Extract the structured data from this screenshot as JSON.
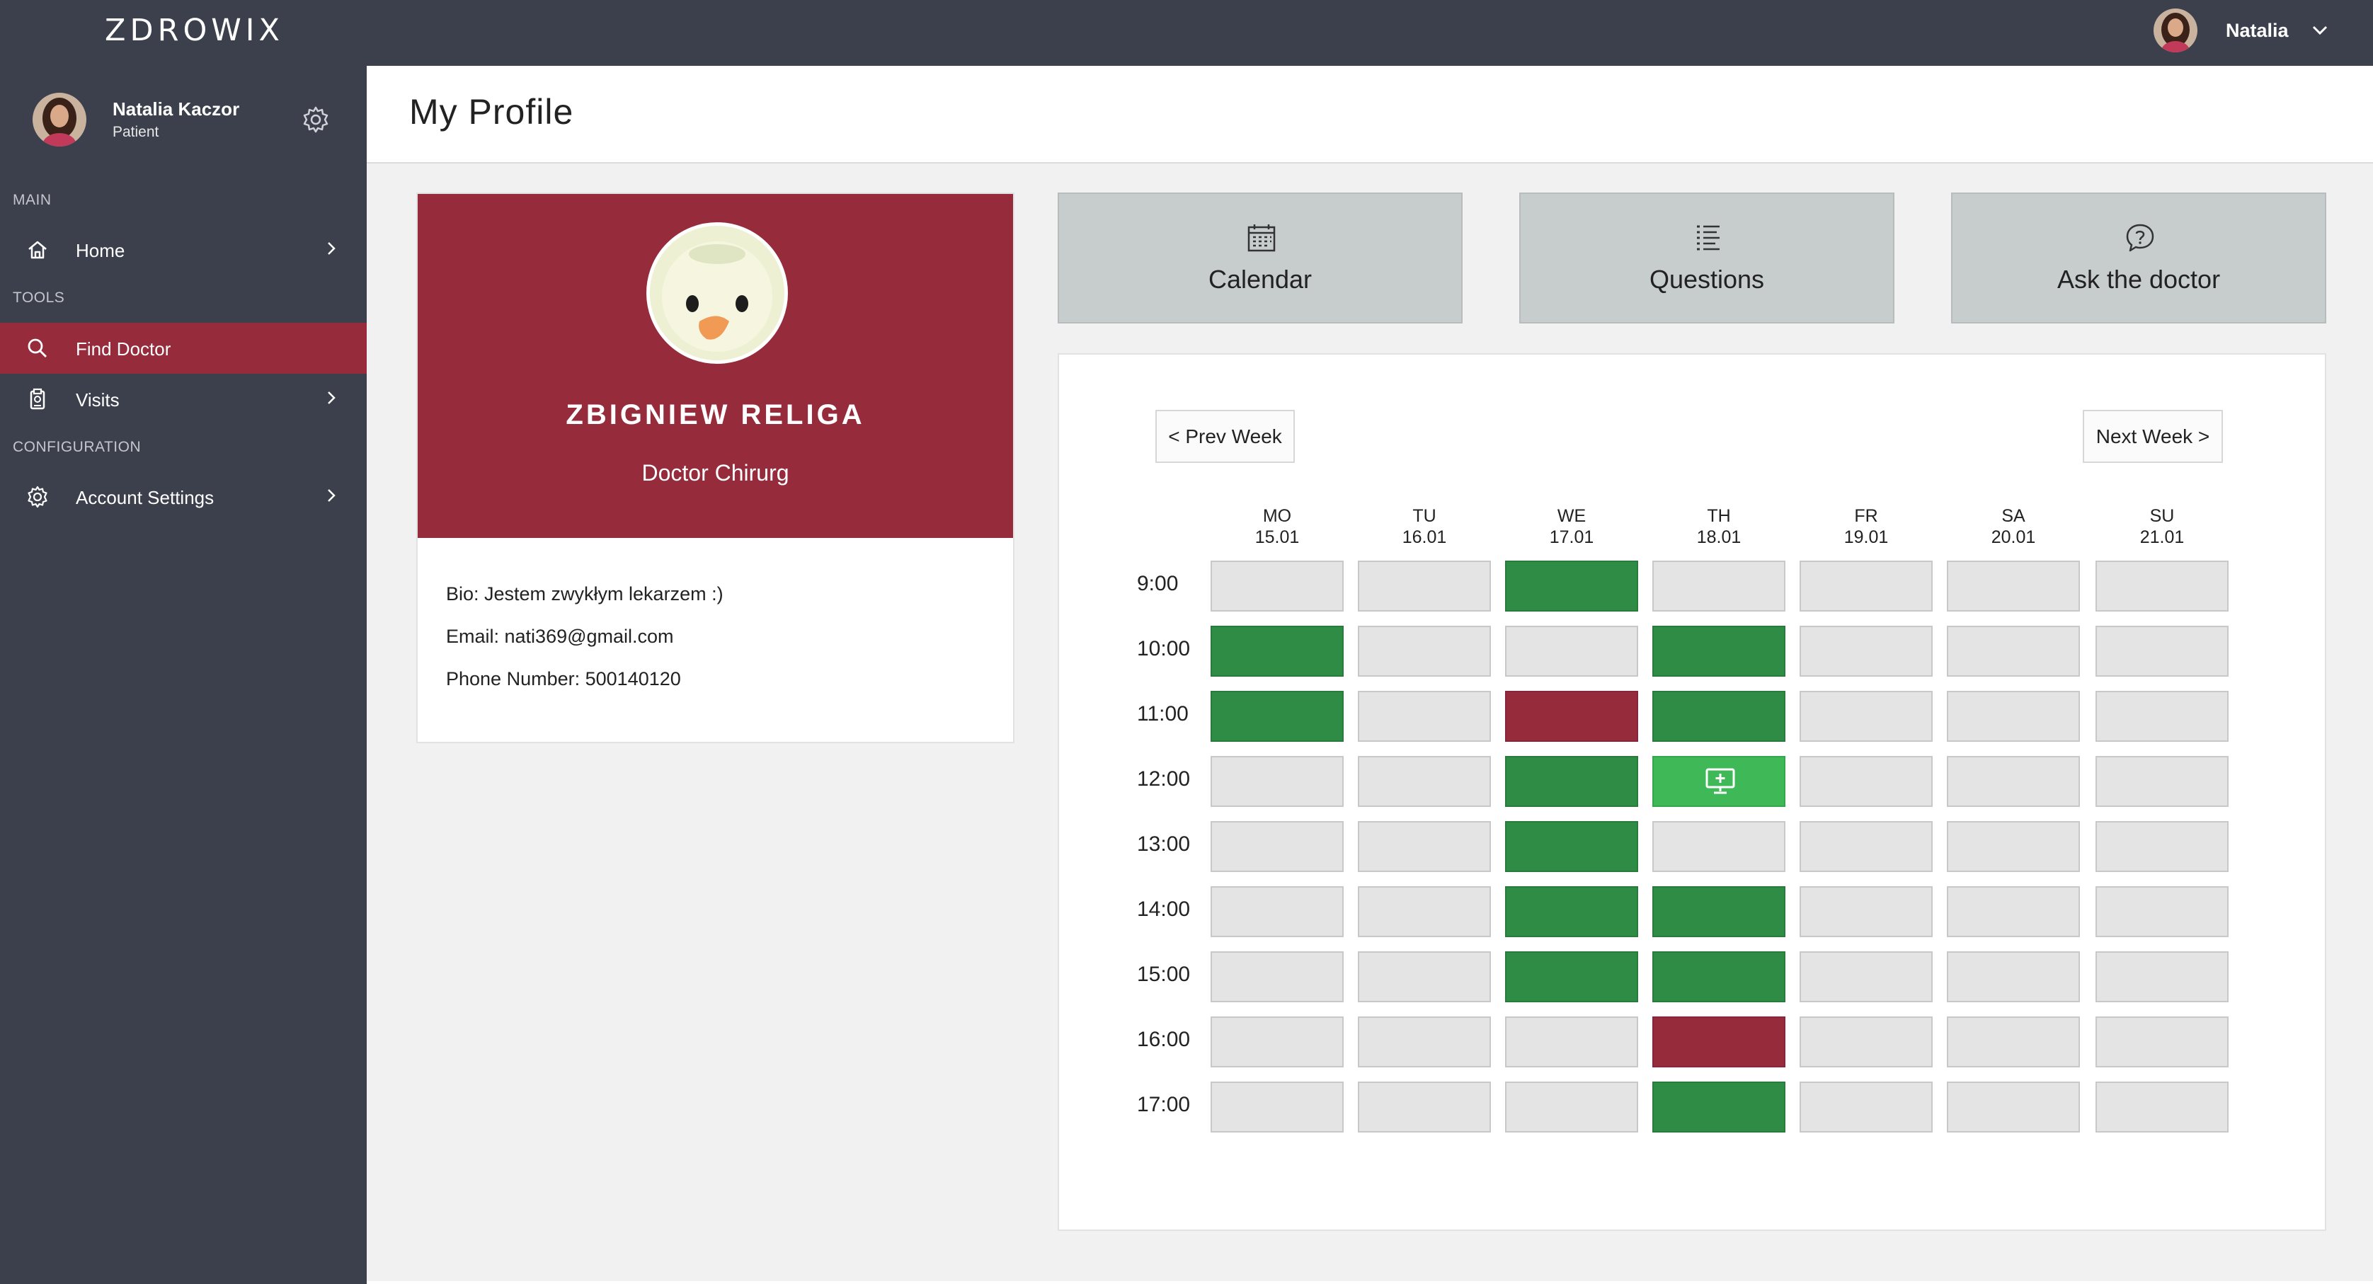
{
  "app": {
    "brand": "ZDROWIX"
  },
  "topbar": {
    "user_name": "Natalia"
  },
  "sidebar": {
    "user": {
      "name": "Natalia Kaczor",
      "role": "Patient"
    },
    "sections": {
      "main": "MAIN",
      "tools": "TOOLS",
      "configuration": "CONFIGURATION"
    },
    "items": [
      {
        "label": "Home",
        "icon": "home-icon",
        "active": false
      },
      {
        "label": "Find Doctor",
        "icon": "search-icon",
        "active": true
      },
      {
        "label": "Visits",
        "icon": "clipboard-icon",
        "active": false
      },
      {
        "label": "Account Settings",
        "icon": "gear-icon",
        "active": false
      }
    ]
  },
  "page": {
    "title": "My Profile"
  },
  "profile": {
    "name": "ZBIGNIEW RELIGA",
    "title": "Doctor Chirurg",
    "bio": "Bio: Jestem zwykłym lekarzem :)",
    "email": "Email: nati369@gmail.com",
    "phone": "Phone Number: 500140120"
  },
  "tiles": [
    {
      "label": "Calendar",
      "icon": "calendar-icon"
    },
    {
      "label": "Questions",
      "icon": "list-icon"
    },
    {
      "label": "Ask the doctor",
      "icon": "question-bubble-icon"
    }
  ],
  "calendar": {
    "prev_label": "< Prev Week",
    "next_label": "Next Week >",
    "days": [
      {
        "name": "MO",
        "date": "15.01"
      },
      {
        "name": "TU",
        "date": "16.01"
      },
      {
        "name": "WE",
        "date": "17.01"
      },
      {
        "name": "TH",
        "date": "18.01"
      },
      {
        "name": "FR",
        "date": "19.01"
      },
      {
        "name": "SA",
        "date": "20.01"
      },
      {
        "name": "SU",
        "date": "21.01"
      }
    ],
    "times": [
      "9:00",
      "10:00",
      "11:00",
      "12:00",
      "13:00",
      "14:00",
      "15:00",
      "16:00",
      "17:00"
    ],
    "slots": [
      [
        "empty",
        "empty",
        "available",
        "empty",
        "empty",
        "empty",
        "empty"
      ],
      [
        "available",
        "empty",
        "empty",
        "available",
        "empty",
        "empty",
        "empty"
      ],
      [
        "available",
        "empty",
        "booked",
        "available",
        "empty",
        "empty",
        "empty"
      ],
      [
        "empty",
        "empty",
        "available",
        "mine",
        "empty",
        "empty",
        "empty"
      ],
      [
        "empty",
        "empty",
        "available",
        "empty",
        "empty",
        "empty",
        "empty"
      ],
      [
        "empty",
        "empty",
        "available",
        "available",
        "empty",
        "empty",
        "empty"
      ],
      [
        "empty",
        "empty",
        "available",
        "available",
        "empty",
        "empty",
        "empty"
      ],
      [
        "empty",
        "empty",
        "empty",
        "booked",
        "empty",
        "empty",
        "empty"
      ],
      [
        "empty",
        "empty",
        "empty",
        "available",
        "empty",
        "empty",
        "empty"
      ]
    ],
    "mine_icon": "monitor-plus-icon"
  },
  "colors": {
    "sidebar_bg": "#3c404d",
    "accent": "#962b3c",
    "available": "#2e8c45",
    "mine": "#3fb957",
    "empty": "#e4e4e4",
    "tile_bg": "#c7cccd"
  }
}
